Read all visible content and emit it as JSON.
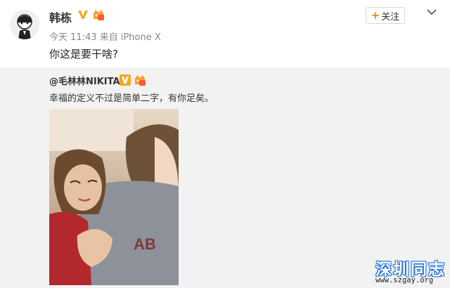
{
  "post": {
    "username": "韩栋",
    "meta": "今天 11:43 来自 iPhone X",
    "text": "你这是要干啥?",
    "follow_label": "关注",
    "follow_plus": "+"
  },
  "repost": {
    "author": "@毛林林NIKITA",
    "text": "幸福的定义不过是简单二字，有你足矣。"
  },
  "watermark": {
    "title": "深圳同志",
    "url": "www.szgay.org"
  },
  "icons": {
    "verified": "verified-v-icon",
    "vip": "vip-crown-icon",
    "more": "chevron-down-icon",
    "avatar": "avatar"
  },
  "colors": {
    "accent": "#ff8200",
    "verified": "#f5a623",
    "repost_bg": "#f2f2f2",
    "watermark_blue": "#1e6fd6"
  }
}
